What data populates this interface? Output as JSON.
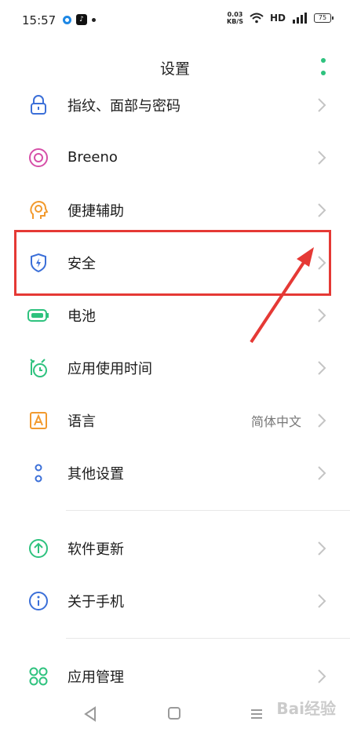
{
  "status": {
    "time": "15:57",
    "speed_top": "0.03",
    "speed_bottom": "KB/S",
    "hd": "HD",
    "battery": "75"
  },
  "header": {
    "title": "设置"
  },
  "settings": {
    "items": [
      {
        "label": "指纹、面部与密码",
        "icon": "lock-icon"
      },
      {
        "label": "Breeno",
        "icon": "breeno-icon"
      },
      {
        "label": "便捷辅助",
        "icon": "accessibility-icon"
      },
      {
        "label": "安全",
        "icon": "shield-icon"
      },
      {
        "label": "电池",
        "icon": "battery-icon"
      },
      {
        "label": "应用使用时间",
        "icon": "alarm-clock-icon"
      },
      {
        "label": "语言",
        "value": "简体中文",
        "icon": "language-icon"
      },
      {
        "label": "其他设置",
        "icon": "dots-icon"
      },
      {
        "label": "软件更新",
        "icon": "update-icon"
      },
      {
        "label": "关于手机",
        "icon": "info-icon"
      },
      {
        "label": "应用管理",
        "icon": "app-grid-icon"
      }
    ]
  },
  "watermark": "Bai经验",
  "colors": {
    "accent_green": "#2ec27e",
    "highlight_red": "#e53935"
  }
}
